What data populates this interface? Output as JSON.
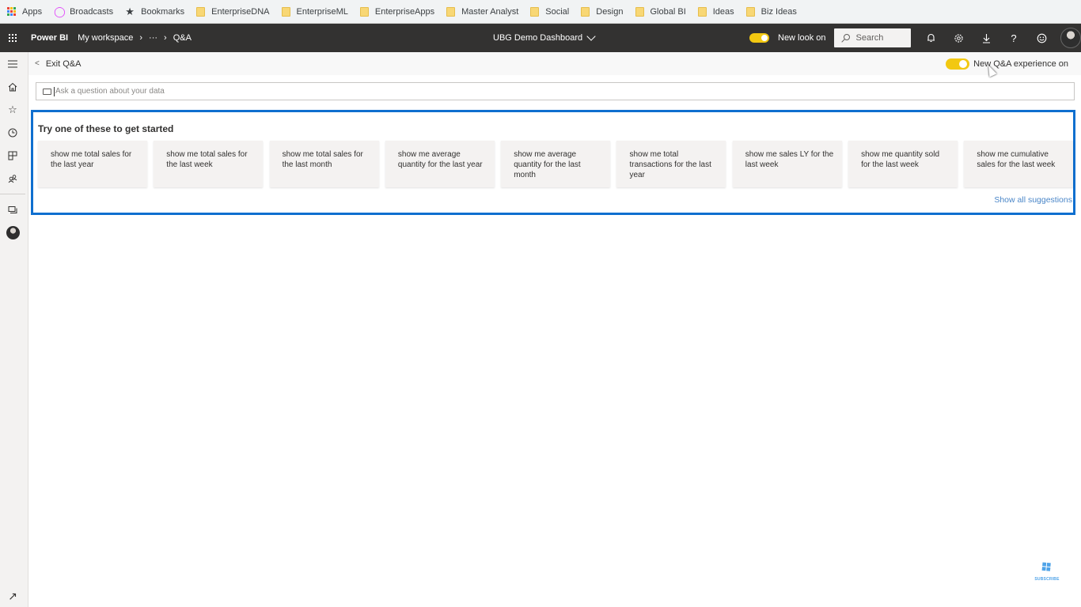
{
  "bookmarks": [
    {
      "label": "Apps",
      "icon": "apps-icon"
    },
    {
      "label": "Broadcasts",
      "icon": "broadcast-icon"
    },
    {
      "label": "Bookmarks",
      "icon": "star-icon"
    },
    {
      "label": "EnterpriseDNA",
      "icon": "folder-icon"
    },
    {
      "label": "EnterpriseML",
      "icon": "folder-icon"
    },
    {
      "label": "EnterpriseApps",
      "icon": "folder-icon"
    },
    {
      "label": "Master Analyst",
      "icon": "folder-icon"
    },
    {
      "label": "Social",
      "icon": "folder-icon"
    },
    {
      "label": "Design",
      "icon": "folder-icon"
    },
    {
      "label": "Global BI",
      "icon": "folder-icon"
    },
    {
      "label": "Ideas",
      "icon": "folder-icon"
    },
    {
      "label": "Biz Ideas",
      "icon": "folder-icon"
    }
  ],
  "header": {
    "brand": "Power BI",
    "breadcrumb": [
      "My workspace",
      "···",
      "Q&A"
    ],
    "dashboard_title": "UBG Demo Dashboard",
    "new_look_label": "New look on",
    "new_look_on": true,
    "search_placeholder": "Search",
    "icons": [
      "bell-icon",
      "gear-icon",
      "download-icon",
      "help-icon",
      "smiley-icon"
    ]
  },
  "sub_header": {
    "exit_label": "Exit Q&A",
    "qa_toggle_label": "New Q&A experience on",
    "qa_toggle_on": true
  },
  "ask": {
    "placeholder": "Ask a question about your data"
  },
  "suggestions": {
    "title": "Try one of these to get started",
    "items": [
      "show me total sales for the last year",
      "show me total sales for the last week",
      "show me total sales for the last month",
      "show me average quantity for the last year",
      "show me average quantity for the last month",
      "show me total transactions for the last year",
      "show me sales LY for the last week",
      "show me quantity sold for the last week",
      "show me cumulative sales for the last week"
    ],
    "show_all_label": "Show all suggestions"
  },
  "subscribe_label": "SUBSCRIBE",
  "colors": {
    "header_bg": "#333231",
    "toggle_on": "#f2c811",
    "highlight_border": "#0f6fcf",
    "link": "#4a86c8"
  }
}
